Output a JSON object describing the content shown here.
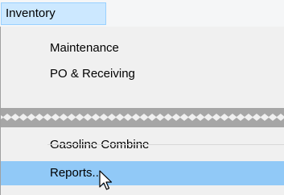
{
  "menubar": {
    "active_menu": "Inventory"
  },
  "menu": {
    "items_top": [
      {
        "label": "Maintenance"
      },
      {
        "label": "PO & Receiving"
      }
    ],
    "items_bottom": [
      {
        "label": "Gasoline Combine"
      },
      {
        "label": "Reports..."
      }
    ],
    "selected_item": "Reports..."
  },
  "colors": {
    "menu_bg": "#f0f0f0",
    "tab_highlight": "#cce8ff",
    "item_highlight": "#91c9f7"
  },
  "icons": {
    "cursor": "arrow-cursor-icon",
    "tear": "torn-edge"
  }
}
